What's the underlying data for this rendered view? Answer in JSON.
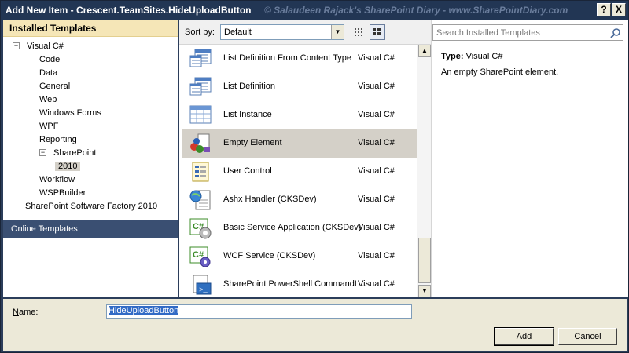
{
  "window": {
    "title": "Add New Item - Crescent.TeamSites.HideUploadButton",
    "watermark": "© Salaudeen Rajack's SharePoint Diary - www.SharePointDiary.com",
    "help_label": "?",
    "close_label": "X"
  },
  "left": {
    "installed_header": "Installed Templates",
    "online_header": "Online Templates",
    "expander_collapse": "−",
    "tree": [
      {
        "label": "Visual C#",
        "expander": true
      },
      {
        "label": "Code"
      },
      {
        "label": "Data"
      },
      {
        "label": "General"
      },
      {
        "label": "Web"
      },
      {
        "label": "Windows Forms"
      },
      {
        "label": "WPF"
      },
      {
        "label": "Reporting"
      },
      {
        "label": "SharePoint",
        "expander": true
      },
      {
        "label": "2010",
        "selected": true
      },
      {
        "label": "Workflow"
      },
      {
        "label": "WSPBuilder"
      },
      {
        "label": "SharePoint Software Factory 2010"
      }
    ]
  },
  "toolbar": {
    "sort_label": "Sort by:",
    "sort_value": "Default"
  },
  "templates": [
    {
      "name": "List Definition From Content Type",
      "lang": "Visual C#",
      "icon": "list-icon"
    },
    {
      "name": "List Definition",
      "lang": "Visual C#",
      "icon": "list-icon"
    },
    {
      "name": "List Instance",
      "lang": "Visual C#",
      "icon": "table-icon"
    },
    {
      "name": "Empty Element",
      "lang": "Visual C#",
      "icon": "sharepoint-element-icon",
      "selected": true
    },
    {
      "name": "User Control",
      "lang": "Visual C#",
      "icon": "user-control-icon"
    },
    {
      "name": "Ashx Handler (CKSDev)",
      "lang": "Visual C#",
      "icon": "globe-page-icon"
    },
    {
      "name": "Basic Service Application (CKSDev)",
      "lang": "Visual C#",
      "icon": "csharp-service-icon"
    },
    {
      "name": "WCF Service (CKSDev)",
      "lang": "Visual C#",
      "icon": "csharp-gear-icon"
    },
    {
      "name": "SharePoint PowerShell CommandL...",
      "lang": "Visual C#",
      "icon": "powershell-icon"
    }
  ],
  "details": {
    "search_placeholder": "Search Installed Templates",
    "type_label": "Type:",
    "type_value": "Visual C#",
    "description": "An empty SharePoint element."
  },
  "bottom": {
    "name_label": "Name:",
    "name_value": "HideUploadButton",
    "add_label": "Add",
    "cancel_label": "Cancel"
  },
  "colors": {
    "title_bg": "#223654",
    "installed_header_bg": "#f5e6b7",
    "online_header_bg": "#3a4f72",
    "selection_bg": "#d4d0c8"
  }
}
